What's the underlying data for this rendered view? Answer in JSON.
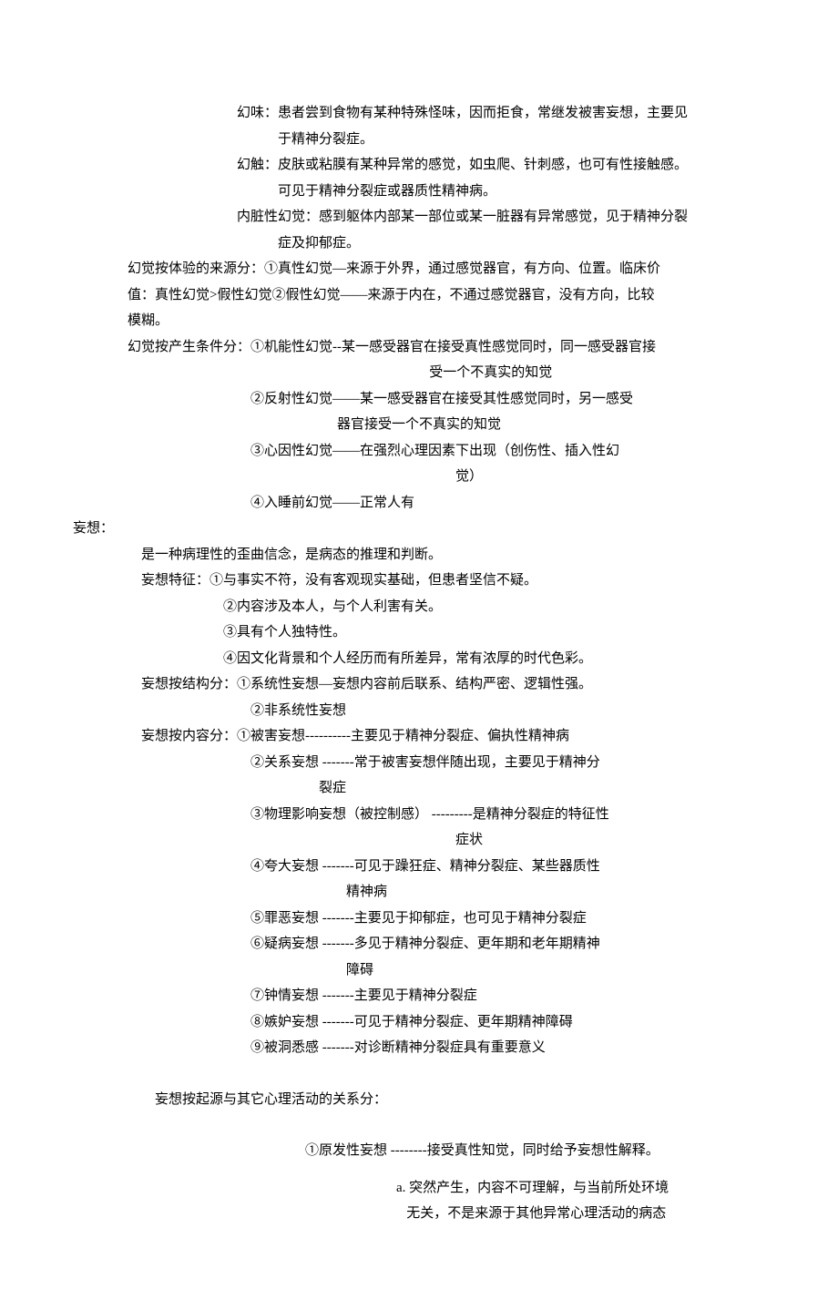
{
  "lines": [
    {
      "cls": "indent-3",
      "text": "幻味：患者尝到食物有某种特殊怪味，因而拒食，常继发被害妄想，主要见"
    },
    {
      "cls": "indent-4b",
      "text": "于精神分裂症。"
    },
    {
      "cls": "indent-3",
      "text": "幻触：皮肤或粘膜有某种异常的感觉，如虫爬、针刺感，也可有性接触感。"
    },
    {
      "cls": "indent-4b",
      "text": "可见于精神分裂症或器质性精神病。"
    },
    {
      "cls": "indent-3",
      "text": "内脏性幻觉：感到躯体内部某一部位或某一脏器有异常感觉，见于精神分裂"
    },
    {
      "cls": "indent-4b",
      "text": "症及抑郁症。"
    },
    {
      "cls": "indent-1",
      "text": "幻觉按体验的来源分：①真性幻觉—来源于外界，通过感觉器官，有方向、位置。临床价"
    },
    {
      "cls": "indent-1",
      "text": "值：真性幻觉>假性幻觉②假性幻觉——来源于内在，不通过感觉器官，没有方向，比较"
    },
    {
      "cls": "indent-1",
      "text": "模糊。"
    },
    {
      "cls": "indent-1",
      "text": "幻觉按产生条件分：①机能性幻觉--某一感受器官在接受真性感觉同时，同一感受器官接"
    },
    {
      "cls": "indent-6c",
      "text": "   受一个不真实的知觉"
    },
    {
      "cls": "indent-4",
      "text": "②反射性幻觉——某一感受器官在接受其性感觉同时，另一感受"
    },
    {
      "cls": "indent-9",
      "text": "器官接受一个不真实的知觉"
    },
    {
      "cls": "indent-4",
      "text": "③心因性幻觉——在强烈心理因素下出现（创伤性、插入性幻"
    },
    {
      "cls": "indent-6b",
      "text": "觉）"
    },
    {
      "cls": "indent-4",
      "text": "④入睡前幻觉——正常人有"
    },
    {
      "cls": "indent-0",
      "text": "妄想："
    },
    {
      "cls": "indent-1",
      "text": "    是一种病理性的歪曲信念，是病态的推理和判断。"
    },
    {
      "cls": "indent-1",
      "text": "    妄想特征：①与事实不符，没有客观现实基础，但患者坚信不疑。"
    },
    {
      "cls": "indent-8",
      "text": "②内容涉及本人，与个人利害有关。"
    },
    {
      "cls": "indent-8",
      "text": "③具有个人独特性。"
    },
    {
      "cls": "indent-8",
      "text": "④因文化背景和个人经历而有所差异，常有浓厚的时代色彩。"
    },
    {
      "cls": "indent-1",
      "text": "    妄想按结构分：①系统性妄想—妄想内容前后联系、结构严密、逻辑性强。"
    },
    {
      "cls": "indent-4",
      "text": "②非系统性妄想"
    },
    {
      "cls": "indent-1",
      "text": "    妄想按内容分：①被害妄想----------主要见于精神分裂症、偏执性精神病"
    },
    {
      "cls": "indent-4",
      "text": "②关系妄想 -------常于被害妄想伴随出现，主要见于精神分"
    },
    {
      "cls": "indent-5",
      "text": "    裂症"
    },
    {
      "cls": "indent-4",
      "text": "③物理影响妄想（被控制感） ---------是精神分裂症的特征性"
    },
    {
      "cls": "indent-6b",
      "text": "症状"
    },
    {
      "cls": "indent-4",
      "text": "④夸大妄想 -------可见于躁狂症、精神分裂症、某些器质性"
    },
    {
      "cls": "indent-6",
      "text": "精神病"
    },
    {
      "cls": "indent-4",
      "text": "⑤罪恶妄想 -------主要见于抑郁症，也可见于精神分裂症"
    },
    {
      "cls": "indent-4",
      "text": "⑥疑病妄想 -------多见于精神分裂症、更年期和老年期精神"
    },
    {
      "cls": "indent-6",
      "text": "障碍"
    },
    {
      "cls": "indent-4",
      "text": "⑦钟情妄想 -------主要见于精神分裂症"
    },
    {
      "cls": "indent-4",
      "text": "⑧嫉妒妄想 -------可见于精神分裂症、更年期精神障碍"
    },
    {
      "cls": "indent-4",
      "text": "⑨被洞悉感 -------对诊断精神分裂症具有重要意义"
    },
    {
      "cls": "spacer",
      "text": ""
    },
    {
      "cls": "indent-2",
      "text": "妄想按起源与其它心理活动的关系分："
    },
    {
      "cls": "spacer",
      "text": ""
    },
    {
      "cls": "indent-5",
      "text": "①原发性妄想 --------接受真性知觉，同时给予妄想性解释。"
    },
    {
      "cls": "spacer-small",
      "text": ""
    },
    {
      "cls": "indent-10",
      "text": "a. 突然产生，内容不可理解，与当前所处环境"
    },
    {
      "cls": "indent-10",
      "text": "   无关，不是来源于其他异常心理活动的病态"
    }
  ]
}
